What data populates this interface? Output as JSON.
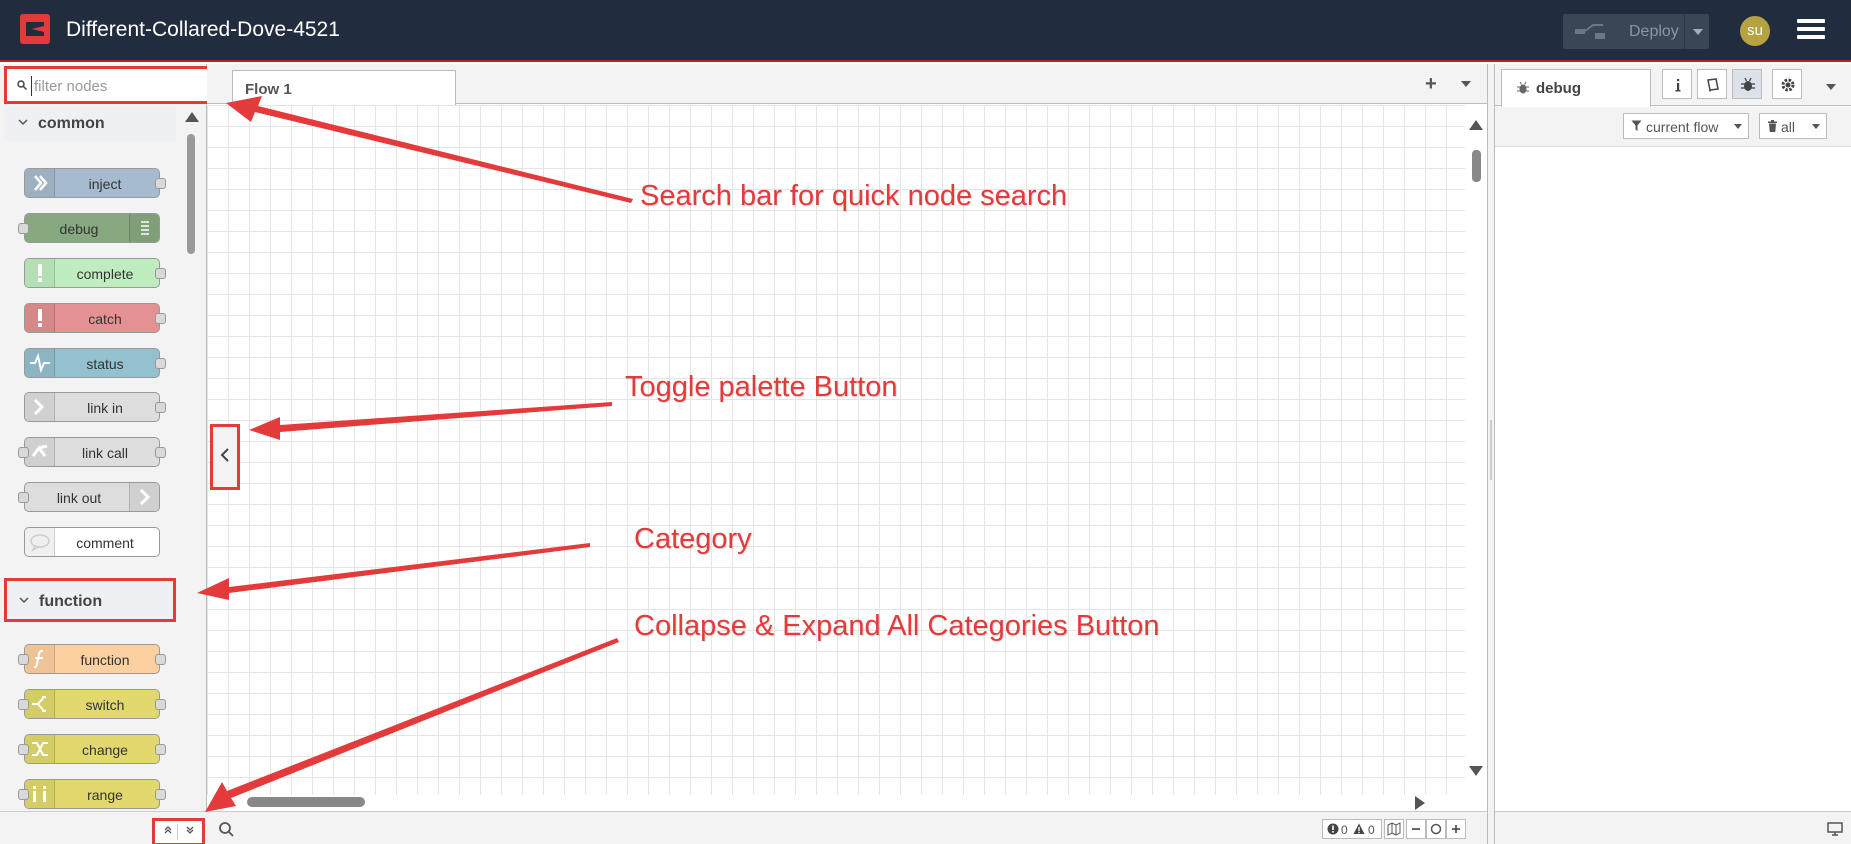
{
  "header": {
    "title": "Different-Collared-Dove-4521",
    "deploy_label": "Deploy",
    "avatar_initials": "su"
  },
  "palette": {
    "search_placeholder": "filter nodes",
    "categories": [
      {
        "name": "common",
        "nodes": [
          {
            "label": "inject",
            "color": "#a6bbcf",
            "icon_side": "left",
            "icon": "arrow-in-icon",
            "ports": "out"
          },
          {
            "label": "debug",
            "color": "#87a980",
            "icon_side": "right",
            "icon": "list-icon",
            "ports": "in"
          },
          {
            "label": "complete",
            "color": "#c0edc0",
            "icon_side": "left",
            "icon": "exclamation-icon",
            "ports": "out"
          },
          {
            "label": "catch",
            "color": "#e49191",
            "icon_side": "left",
            "icon": "exclamation-icon",
            "ports": "out"
          },
          {
            "label": "status",
            "color": "#94c1d0",
            "icon_side": "left",
            "icon": "pulse-icon",
            "ports": "out"
          },
          {
            "label": "link in",
            "color": "#dddddd",
            "icon_side": "left",
            "icon": "link-in-icon",
            "ports": "out"
          },
          {
            "label": "link call",
            "color": "#dddddd",
            "icon_side": "left",
            "icon": "link-call-icon",
            "ports": "both"
          },
          {
            "label": "link out",
            "color": "#dddddd",
            "icon_side": "right",
            "icon": "link-out-icon",
            "ports": "in"
          },
          {
            "label": "comment",
            "color": "#ffffff",
            "icon_side": "left",
            "icon": "comment-icon",
            "ports": "none"
          }
        ]
      },
      {
        "name": "function",
        "nodes": [
          {
            "label": "function",
            "color": "#fdd0a2",
            "icon_side": "left",
            "icon": "function-icon",
            "ports": "both"
          },
          {
            "label": "switch",
            "color": "#e2d96e",
            "icon_side": "left",
            "icon": "switch-icon",
            "ports": "both"
          },
          {
            "label": "change",
            "color": "#e2d96e",
            "icon_side": "left",
            "icon": "shuffle-icon",
            "ports": "both"
          },
          {
            "label": "range",
            "color": "#e2d96e",
            "icon_side": "left",
            "icon": "range-icon",
            "ports": "both"
          }
        ]
      }
    ]
  },
  "workspace": {
    "tabs": [
      {
        "label": "Flow 1"
      }
    ],
    "add_tab": "+",
    "footer": {
      "errors": "0",
      "warnings": "0"
    }
  },
  "sidebar": {
    "active_tab": "debug",
    "filter_flow": "current flow",
    "filter_all": "all"
  },
  "annotations": [
    {
      "text": "Search bar for quick node search"
    },
    {
      "text": "Toggle palette Button"
    },
    {
      "text": "Category"
    },
    {
      "text": "Collapse & Expand All Categories Button"
    }
  ],
  "colors": {
    "header_bg": "#212d3e",
    "annotation_red": "#e33b3b",
    "accent_bar": "#c02020"
  }
}
